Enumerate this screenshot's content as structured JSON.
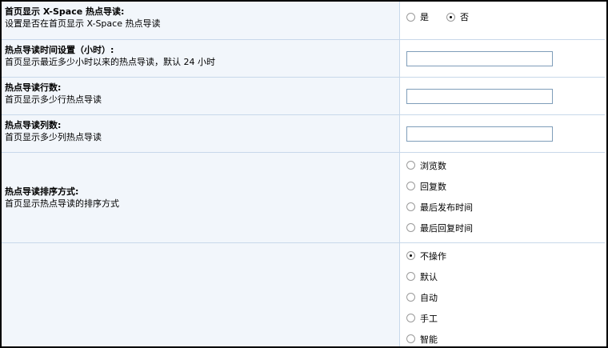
{
  "rows": {
    "hot_display": {
      "title": "首页显示 X-Space 热点导读:",
      "desc": "设置是否在首页显示 X-Space 热点导读",
      "options": [
        "是",
        "否"
      ],
      "selected": "否"
    },
    "hot_hours": {
      "title": "热点导读时间设置（小时）:",
      "desc": "首页显示最近多少小时以来的热点导读，默认 24 小时",
      "value": ""
    },
    "hot_rows": {
      "title": "热点导读行数:",
      "desc": "首页显示多少行热点导读",
      "value": ""
    },
    "hot_cols": {
      "title": "热点导读列数:",
      "desc": "首页显示多少列热点导读",
      "value": ""
    },
    "hot_sort": {
      "title": "热点导读排序方式:",
      "desc": "首页显示热点导读的排序方式",
      "options": [
        "浏览数",
        "回复数",
        "最后发布时间",
        "最后回复时间"
      ]
    },
    "operation": {
      "title": "",
      "options": [
        "不操作",
        "默认",
        "自动",
        "手工",
        "智能"
      ],
      "selected": "不操作"
    }
  }
}
